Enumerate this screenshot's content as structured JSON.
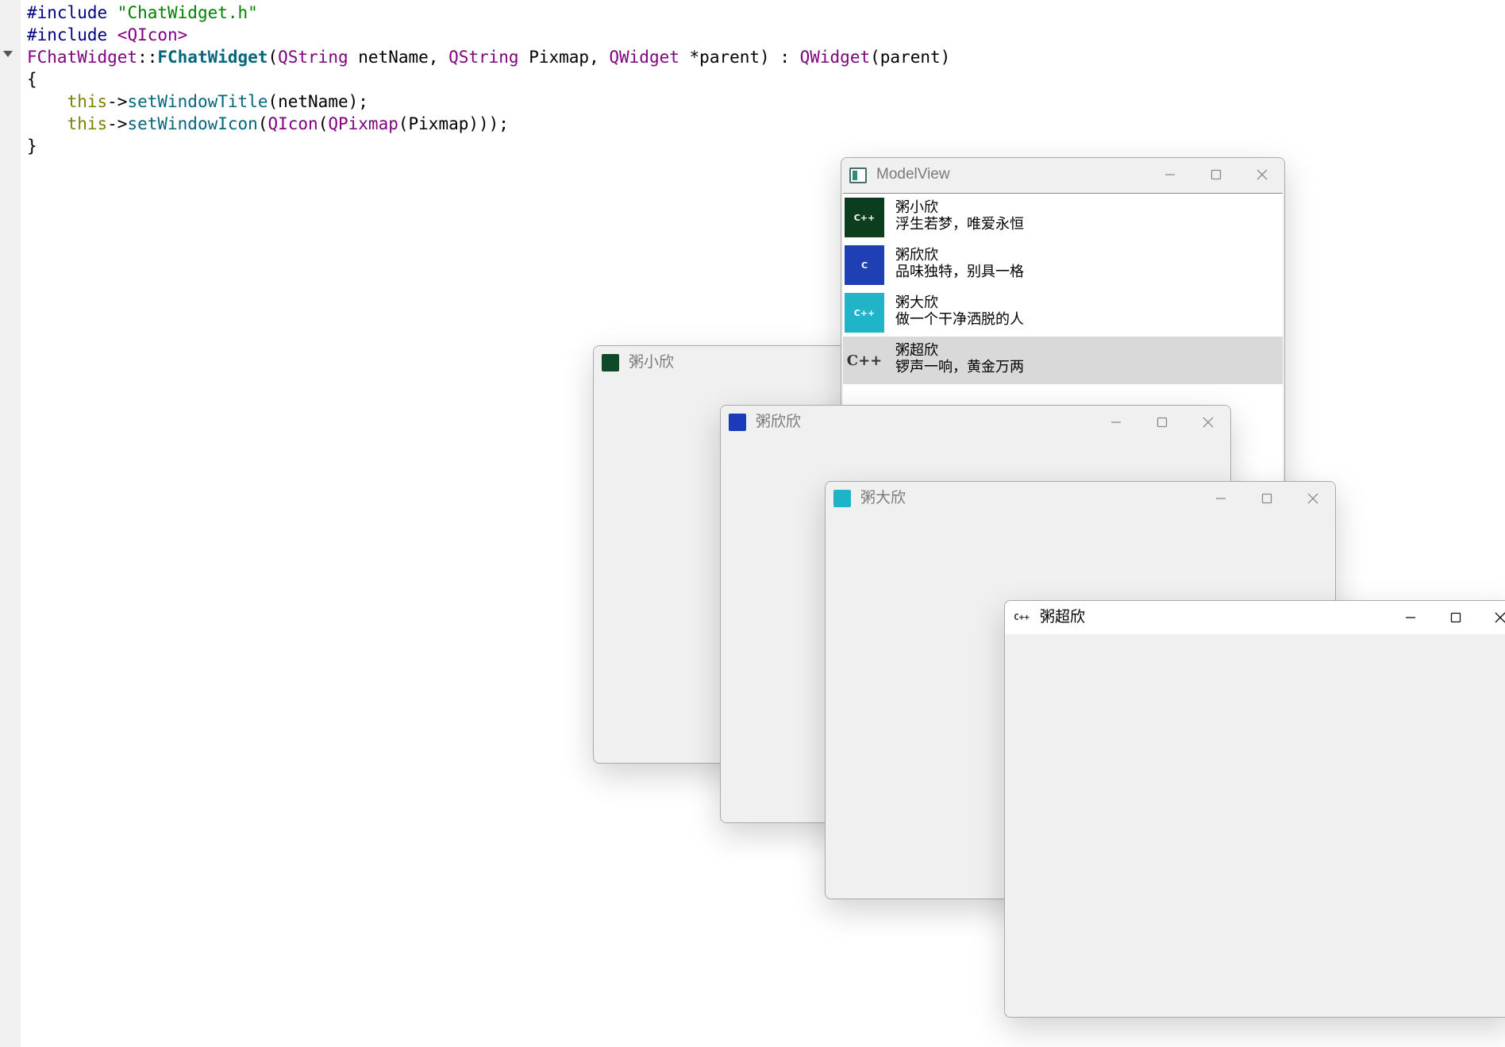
{
  "editor": {
    "lines": [
      [
        {
          "t": "#include ",
          "c": "kw-pp"
        },
        {
          "t": "\"ChatWidget.h\"",
          "c": "str"
        }
      ],
      [
        {
          "t": "#include ",
          "c": "kw-pp"
        },
        {
          "t": "<QIcon>",
          "c": "cls"
        }
      ],
      [
        {
          "t": "FChatWidget",
          "c": "cls"
        },
        {
          "t": "::",
          "c": "pl"
        },
        {
          "t": "FChatWidget",
          "c": "fn-b"
        },
        {
          "t": "(",
          "c": "pl"
        },
        {
          "t": "QString",
          "c": "cls"
        },
        {
          "t": " netName, ",
          "c": "pl"
        },
        {
          "t": "QString",
          "c": "cls"
        },
        {
          "t": " Pixmap, ",
          "c": "pl"
        },
        {
          "t": "QWidget",
          "c": "cls"
        },
        {
          "t": " *parent) : ",
          "c": "pl"
        },
        {
          "t": "QWidget",
          "c": "cls"
        },
        {
          "t": "(parent)",
          "c": "pl"
        }
      ],
      [
        {
          "t": "{",
          "c": "pl"
        }
      ],
      [
        {
          "t": "    ",
          "c": "pl"
        },
        {
          "t": "this",
          "c": "this"
        },
        {
          "t": "->",
          "c": "pl"
        },
        {
          "t": "setWindowTitle",
          "c": "fn"
        },
        {
          "t": "(netName);",
          "c": "pl"
        }
      ],
      [
        {
          "t": "    ",
          "c": "pl"
        },
        {
          "t": "this",
          "c": "this"
        },
        {
          "t": "->",
          "c": "pl"
        },
        {
          "t": "setWindowIcon",
          "c": "fn"
        },
        {
          "t": "(",
          "c": "pl"
        },
        {
          "t": "QIcon",
          "c": "cls"
        },
        {
          "t": "(",
          "c": "pl"
        },
        {
          "t": "QPixmap",
          "c": "cls"
        },
        {
          "t": "(Pixmap)));",
          "c": "pl"
        }
      ],
      [
        {
          "t": "}",
          "c": "pl"
        }
      ]
    ]
  },
  "windows": {
    "xiao": {
      "title": "粥小欣",
      "icon_color": "#0e4a2a"
    },
    "xinxin": {
      "title": "粥欣欣",
      "icon_color": "#1a3cb8"
    },
    "da": {
      "title": "粥大欣",
      "icon_color": "#1eb3c6"
    },
    "chao": {
      "title": "粥超欣",
      "icon_color": "#ffffff"
    },
    "modelview": {
      "title": "ModelView",
      "items": [
        {
          "name": "粥小欣",
          "signature": "浮生若梦，唯爱永恒",
          "avatar_color": "#0b3d1f",
          "avatar_text": "C++",
          "selected": false
        },
        {
          "name": "粥欣欣",
          "signature": "品味独特，别具一格",
          "avatar_color": "#1f3fb5",
          "avatar_text": "C",
          "selected": false
        },
        {
          "name": "粥大欣",
          "signature": "做一个干净洒脱的人",
          "avatar_color": "#1fb4c8",
          "avatar_text": "C++",
          "selected": false
        },
        {
          "name": "粥超欣",
          "signature": "锣声一响，黄金万两",
          "avatar_color": "#d9d9d9",
          "avatar_text": "C++",
          "selected": true
        }
      ]
    }
  }
}
